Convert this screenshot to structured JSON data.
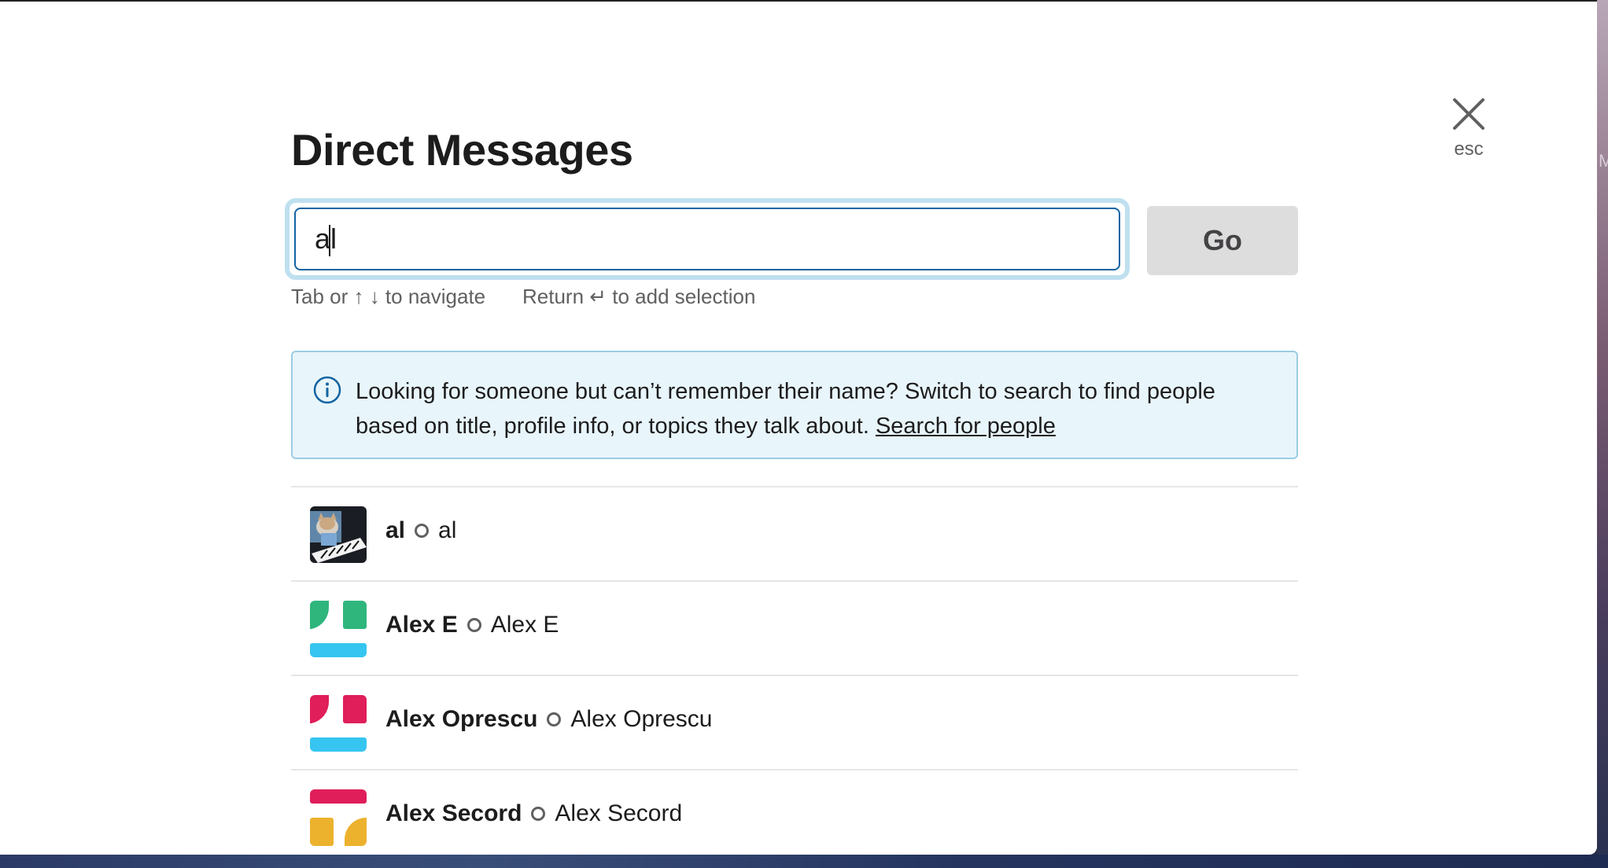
{
  "dialog": {
    "title": "Direct Messages",
    "close_label": "esc"
  },
  "search": {
    "value": "al",
    "go_label": "Go"
  },
  "hints": {
    "navigate": "Tab or ↑ ↓ to navigate",
    "select": "Return ↵ to add selection"
  },
  "info": {
    "text": "Looking for someone but can’t remember their name? Switch to search to find people based on title, profile info, or topics they talk about.",
    "link_label": "Search for people"
  },
  "results": [
    {
      "display_name": "al",
      "real_name": "al",
      "avatar_icon": "cat-keyboard-avatar"
    },
    {
      "display_name": "Alex E",
      "real_name": "Alex E",
      "avatar_icon": "default-avatar-green"
    },
    {
      "display_name": "Alex Oprescu",
      "real_name": "Alex Oprescu",
      "avatar_icon": "default-avatar-red"
    },
    {
      "display_name": "Alex Secord",
      "real_name": "Alex Secord",
      "avatar_icon": "default-avatar-yellow"
    }
  ],
  "colors": {
    "accent_blue": "#1264a3",
    "focus_ring": "#bfe0ef",
    "info_bg": "#e8f5fa",
    "avatar_green": "#2eb67d",
    "avatar_red": "#e01e5a",
    "avatar_blue": "#36c5f0",
    "avatar_yellow": "#ecb22e"
  }
}
